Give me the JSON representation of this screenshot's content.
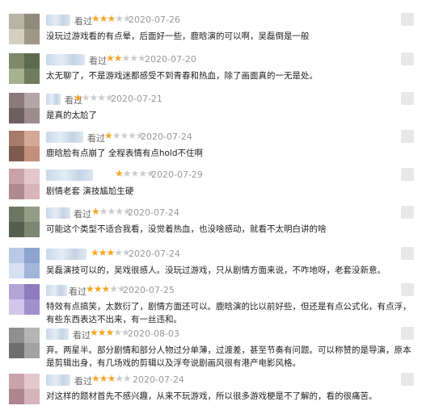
{
  "seen_label": "看过",
  "reviews": [
    {
      "date": "2020-07-26",
      "rating": 3,
      "text": "没玩过游戏看的有点晕，后面好一些，鹿晗演的可以啊，吴磊倒是一般"
    },
    {
      "date": "2020-07-20",
      "rating": 2,
      "text": "太无聊了，不是游戏迷都感受不到青春和热血，除了画面真的一无是处。"
    },
    {
      "date": "2020-07-21",
      "rating": 1,
      "text": "是真的太尬了"
    },
    {
      "date": "2020-07-24",
      "rating": 1,
      "text": "鹿晗脸有点崩了 全程表情有点hold不住啊"
    },
    {
      "date": "2020-07-29",
      "rating": 1,
      "text": "剧情老套 演技尴尬生硬"
    },
    {
      "date": "2020-07-24",
      "rating": 1,
      "text": "可能这个类型不适合我看，没觉着热血，也没啥感动，就看不太明白讲的啥"
    },
    {
      "date": "2020-07-24",
      "rating": 3,
      "text": "吴磊演技可以的，吴戏很感人。没玩过游戏，只从剧情方面来说，不咋地呀，老套没新意。"
    },
    {
      "date": "2020-07-25",
      "rating": 3,
      "text": "特效有点搞笑，太数衍了，剧情方面还可以。鹿晗演的比以前好些，但还是有点公式化，有点浮，有些东西表达不出来，有一丝违和。"
    },
    {
      "date": "2020-08-03",
      "rating": 3,
      "text": "弃。两星半。部分剧情和部分人物过分单薄，过渡差，甚至节奏有问题。可以称赞的是导演，原本是剪辑出身，有几场戏的剪辑以及浮夸说剧画风很有港产电影风格。"
    },
    {
      "date": "2020-07-24",
      "rating": 3,
      "text": "对这样的题材首先不感兴趣，从来不玩游戏，所以很多游戏梗是不了解的，看的很痛苦。"
    }
  ]
}
